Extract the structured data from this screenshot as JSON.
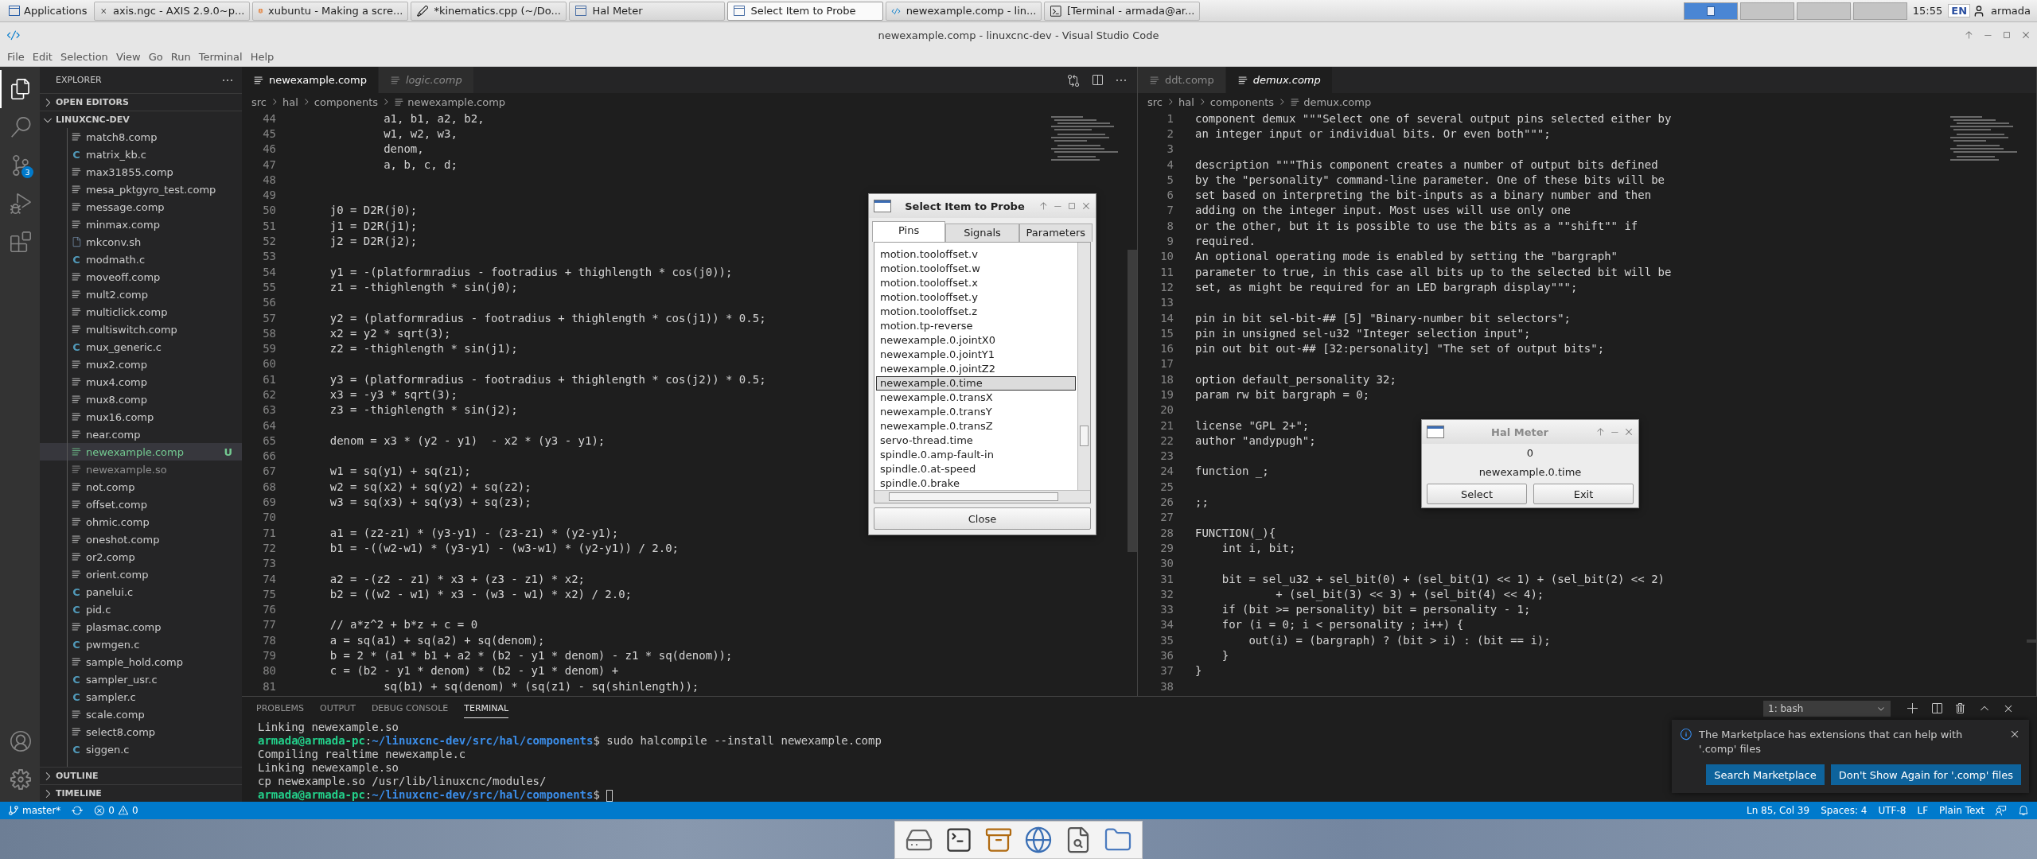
{
  "top_panel": {
    "menu_label": "Applications",
    "tasks": [
      {
        "kind": "axis",
        "label": "axis.ngc - AXIS 2.9.0~p...",
        "selected": false
      },
      {
        "kind": "browser",
        "label": "xubuntu - Making a scre...",
        "selected": false
      },
      {
        "kind": "editor",
        "label": "*kinematics.cpp (~/Do...",
        "selected": false
      },
      {
        "kind": "window",
        "label": "Hal Meter",
        "selected": false
      },
      {
        "kind": "window",
        "label": "Select Item to Probe",
        "selected": true
      },
      {
        "kind": "vscode",
        "label": "newexample.comp - lin...",
        "selected": false
      },
      {
        "kind": "terminal",
        "label": "[Terminal - armada@ar...",
        "selected": false
      }
    ],
    "workspaces": [
      {
        "selected": true
      },
      {
        "selected": false
      },
      {
        "selected": false
      },
      {
        "selected": false
      }
    ],
    "clock": "15:55",
    "keyboard": "EN",
    "user": "armada"
  },
  "window": {
    "title": "newexample.comp - linuxcnc-dev - Visual Studio Code"
  },
  "menu": [
    "File",
    "Edit",
    "Selection",
    "View",
    "Go",
    "Run",
    "Terminal",
    "Help"
  ],
  "activity_bar": {
    "items": [
      {
        "kind": "files",
        "selected": true
      },
      {
        "kind": "search",
        "selected": false
      },
      {
        "kind": "scm",
        "selected": false,
        "badge": "3"
      },
      {
        "kind": "debug",
        "selected": false
      },
      {
        "kind": "extensions",
        "selected": false
      }
    ],
    "bottom": [
      {
        "kind": "account"
      },
      {
        "kind": "settings"
      }
    ]
  },
  "sidebar": {
    "title": "EXPLORER",
    "sections": [
      {
        "label": "OPEN EDITORS",
        "expanded": false
      },
      {
        "label": "LINUXCNC-DEV",
        "expanded": true
      }
    ],
    "files": [
      {
        "name": "match8.comp",
        "kind": "comp",
        "untracked": false,
        "ignored": false,
        "selected": false
      },
      {
        "name": "matrix_kb.c",
        "kind": "c",
        "glyph": "C",
        "untracked": false,
        "ignored": false,
        "selected": false
      },
      {
        "name": "max31855.comp",
        "kind": "comp",
        "untracked": false,
        "ignored": false,
        "selected": false
      },
      {
        "name": "mesa_pktgyro_test.comp",
        "kind": "comp",
        "untracked": false,
        "ignored": false,
        "selected": false
      },
      {
        "name": "message.comp",
        "kind": "comp",
        "untracked": false,
        "ignored": false,
        "selected": false
      },
      {
        "name": "minmax.comp",
        "kind": "comp",
        "untracked": false,
        "ignored": false,
        "selected": false
      },
      {
        "name": "mkconv.sh",
        "kind": "shell",
        "untracked": false,
        "ignored": false,
        "selected": false
      },
      {
        "name": "modmath.c",
        "kind": "c",
        "glyph": "C",
        "untracked": false,
        "ignored": false,
        "selected": false
      },
      {
        "name": "moveoff.comp",
        "kind": "comp",
        "untracked": false,
        "ignored": false,
        "selected": false
      },
      {
        "name": "mult2.comp",
        "kind": "comp",
        "untracked": false,
        "ignored": false,
        "selected": false
      },
      {
        "name": "multiclick.comp",
        "kind": "comp",
        "untracked": false,
        "ignored": false,
        "selected": false
      },
      {
        "name": "multiswitch.comp",
        "kind": "comp",
        "untracked": false,
        "ignored": false,
        "selected": false
      },
      {
        "name": "mux_generic.c",
        "kind": "c",
        "glyph": "C",
        "untracked": false,
        "ignored": false,
        "selected": false
      },
      {
        "name": "mux2.comp",
        "kind": "comp",
        "untracked": false,
        "ignored": false,
        "selected": false
      },
      {
        "name": "mux4.comp",
        "kind": "comp",
        "untracked": false,
        "ignored": false,
        "selected": false
      },
      {
        "name": "mux8.comp",
        "kind": "comp",
        "untracked": false,
        "ignored": false,
        "selected": false
      },
      {
        "name": "mux16.comp",
        "kind": "comp",
        "untracked": false,
        "ignored": false,
        "selected": false
      },
      {
        "name": "near.comp",
        "kind": "comp",
        "untracked": false,
        "ignored": false,
        "selected": false
      },
      {
        "name": "newexample.comp",
        "kind": "comp",
        "untracked": true,
        "ignored": false,
        "badge": "U",
        "selected": true
      },
      {
        "name": "newexample.so",
        "kind": "comp",
        "untracked": false,
        "ignored": true,
        "selected": false
      },
      {
        "name": "not.comp",
        "kind": "comp",
        "untracked": false,
        "ignored": false,
        "selected": false
      },
      {
        "name": "offset.comp",
        "kind": "comp",
        "untracked": false,
        "ignored": false,
        "selected": false
      },
      {
        "name": "ohmic.comp",
        "kind": "comp",
        "untracked": false,
        "ignored": false,
        "selected": false
      },
      {
        "name": "oneshot.comp",
        "kind": "comp",
        "untracked": false,
        "ignored": false,
        "selected": false
      },
      {
        "name": "or2.comp",
        "kind": "comp",
        "untracked": false,
        "ignored": false,
        "selected": false
      },
      {
        "name": "orient.comp",
        "kind": "comp",
        "untracked": false,
        "ignored": false,
        "selected": false
      },
      {
        "name": "panelui.c",
        "kind": "c",
        "glyph": "C",
        "untracked": false,
        "ignored": false,
        "selected": false
      },
      {
        "name": "pid.c",
        "kind": "c",
        "glyph": "C",
        "untracked": false,
        "ignored": false,
        "selected": false
      },
      {
        "name": "plasmac.comp",
        "kind": "comp",
        "untracked": false,
        "ignored": false,
        "selected": false
      },
      {
        "name": "pwmgen.c",
        "kind": "c",
        "glyph": "C",
        "untracked": false,
        "ignored": false,
        "selected": false
      },
      {
        "name": "sample_hold.comp",
        "kind": "comp",
        "untracked": false,
        "ignored": false,
        "selected": false
      },
      {
        "name": "sampler_usr.c",
        "kind": "c",
        "glyph": "C",
        "untracked": false,
        "ignored": false,
        "selected": false
      },
      {
        "name": "sampler.c",
        "kind": "c",
        "glyph": "C",
        "untracked": false,
        "ignored": false,
        "selected": false
      },
      {
        "name": "scale.comp",
        "kind": "comp",
        "untracked": false,
        "ignored": false,
        "selected": false
      },
      {
        "name": "select8.comp",
        "kind": "comp",
        "untracked": false,
        "ignored": false,
        "selected": false
      },
      {
        "name": "siggen.c",
        "kind": "c",
        "glyph": "C",
        "untracked": false,
        "ignored": false,
        "selected": false
      }
    ],
    "bottom_sections": [
      {
        "label": "OUTLINE",
        "expanded": false
      },
      {
        "label": "TIMELINE",
        "expanded": false
      }
    ]
  },
  "editor_groups": [
    {
      "tabs": [
        {
          "label": "newexample.comp",
          "selected": true,
          "preview": false
        },
        {
          "label": "logic.comp",
          "selected": false,
          "preview": true
        }
      ],
      "actions": [
        {
          "kind": "compare"
        },
        {
          "kind": "split"
        },
        {
          "kind": "more"
        }
      ],
      "breadcrumb": [
        "src",
        "hal",
        "components",
        "newexample.comp"
      ],
      "lines": [
        {
          "n": "44",
          "text": "            a1, b1, a2, b2,"
        },
        {
          "n": "45",
          "text": "            w1, w2, w3,"
        },
        {
          "n": "46",
          "text": "            denom,"
        },
        {
          "n": "47",
          "text": "            a, b, c, d;"
        },
        {
          "n": "48"
        },
        {
          "n": "49"
        },
        {
          "n": "50",
          "text": "    j0 = D2R(j0);"
        },
        {
          "n": "51",
          "text": "    j1 = D2R(j1);"
        },
        {
          "n": "52",
          "text": "    j2 = D2R(j2);"
        },
        {
          "n": "53"
        },
        {
          "n": "54",
          "text": "    y1 = -(platformradius - footradius + thighlength * cos(j0));"
        },
        {
          "n": "55",
          "text": "    z1 = -thighlength * sin(j0);"
        },
        {
          "n": "56"
        },
        {
          "n": "57",
          "text": "    y2 = (platformradius - footradius + thighlength * cos(j1)) * 0.5;"
        },
        {
          "n": "58",
          "text": "    x2 = y2 * sqrt(3);"
        },
        {
          "n": "59",
          "text": "    z2 = -thighlength * sin(j1);"
        },
        {
          "n": "60"
        },
        {
          "n": "61",
          "text": "    y3 = (platformradius - footradius + thighlength * cos(j2)) * 0.5;"
        },
        {
          "n": "62",
          "text": "    x3 = -y3 * sqrt(3);"
        },
        {
          "n": "63",
          "text": "    z3 = -thighlength * sin(j2);"
        },
        {
          "n": "64"
        },
        {
          "n": "65",
          "text": "    denom = x3 * (y2 - y1)  - x2 * (y3 - y1);"
        },
        {
          "n": "66"
        },
        {
          "n": "67",
          "text": "    w1 = sq(y1) + sq(z1);"
        },
        {
          "n": "68",
          "text": "    w2 = sq(x2) + sq(y2) + sq(z2);"
        },
        {
          "n": "69",
          "text": "    w3 = sq(x3) + sq(y3) + sq(z3);"
        },
        {
          "n": "70"
        },
        {
          "n": "71",
          "text": "    a1 = (z2-z1) * (y3-y1) - (z3-z1) * (y2-y1);"
        },
        {
          "n": "72",
          "text": "    b1 = -((w2-w1) * (y3-y1) - (w3-w1) * (y2-y1)) / 2.0;"
        },
        {
          "n": "73"
        },
        {
          "n": "74",
          "text": "    a2 = -(z2 - z1) * x3 + (z3 - z1) * x2;"
        },
        {
          "n": "75",
          "text": "    b2 = ((w2 - w1) * x3 - (w3 - w1) * x2) / 2.0;"
        },
        {
          "n": "76"
        },
        {
          "n": "77",
          "text": "    // a*z^2 + b*z + c = 0"
        },
        {
          "n": "78",
          "text": "    a = sq(a1) + sq(a2) + sq(denom);"
        },
        {
          "n": "79",
          "text": "    b = 2 * (a1 * b1 + a2 * (b2 - y1 * denom) - z1 * sq(denom));"
        },
        {
          "n": "80",
          "text": "    c = (b2 - y1 * denom) * (b2 - y1 * denom) +"
        },
        {
          "n": "81",
          "text": "            sq(b1) + sq(denom) * (sq(z1) - sq(shinlength));"
        }
      ]
    },
    {
      "tabs": [
        {
          "label": "ddt.comp",
          "selected": false,
          "preview": false
        },
        {
          "label": "demux.comp",
          "selected": true,
          "preview": true
        }
      ],
      "breadcrumb": [
        "src",
        "hal",
        "components",
        "demux.comp"
      ],
      "lines": [
        {
          "n": "1",
          "text": "component demux \"\"\"Select one of several output pins selected either by"
        },
        {
          "n": "2",
          "text": "an integer input or individual bits. Or even both\"\"\";"
        },
        {
          "n": "3"
        },
        {
          "n": "4",
          "text": "description \"\"\"This component creates a number of output bits defined"
        },
        {
          "n": "5",
          "text": "by the \"personality\" command-line parameter. One of these bits will be"
        },
        {
          "n": "6",
          "text": "set based on interpreting the bit-inputs as a binary number and then"
        },
        {
          "n": "7",
          "text": "adding on the integer input. Most uses will use only one"
        },
        {
          "n": "8",
          "text": "or the other, but it is possible to use the bits as a \"\"shift\"\" if"
        },
        {
          "n": "9",
          "text": "required."
        },
        {
          "n": "10",
          "text": "An optional operating mode is enabled by setting the \"bargraph\""
        },
        {
          "n": "11",
          "text": "parameter to true, in this case all bits up to the selected bit will be"
        },
        {
          "n": "12",
          "text": "set, as might be required for an LED bargraph display\"\"\";"
        },
        {
          "n": "13"
        },
        {
          "n": "14",
          "text": "pin in bit sel-bit-## [5] \"Binary-number bit selectors\";"
        },
        {
          "n": "15",
          "text": "pin in unsigned sel-u32 \"Integer selection input\";"
        },
        {
          "n": "16",
          "text": "pin out bit out-## [32:personality] \"The set of output bits\";"
        },
        {
          "n": "17"
        },
        {
          "n": "18",
          "text": "option default_personality 32;"
        },
        {
          "n": "19",
          "text": "param rw bit bargraph = 0;"
        },
        {
          "n": "20"
        },
        {
          "n": "21",
          "text": "license \"GPL 2+\";"
        },
        {
          "n": "22",
          "text": "author \"andypugh\";"
        },
        {
          "n": "23"
        },
        {
          "n": "24",
          "text": "function _;"
        },
        {
          "n": "25"
        },
        {
          "n": "26",
          "text": ";;"
        },
        {
          "n": "27"
        },
        {
          "n": "28",
          "text": "FUNCTION(_){"
        },
        {
          "n": "29",
          "text": "    int i, bit;"
        },
        {
          "n": "30"
        },
        {
          "n": "31",
          "text": "    bit = sel_u32 + sel_bit(0) + (sel_bit(1) << 1) + (sel_bit(2) << 2)"
        },
        {
          "n": "32",
          "text": "            + (sel_bit(3) << 3) + (sel_bit(4) << 4);"
        },
        {
          "n": "33",
          "text": "    if (bit >= personality) bit = personality - 1;"
        },
        {
          "n": "34",
          "text": "    for (i = 0; i < personality ; i++) {"
        },
        {
          "n": "35",
          "text": "        out(i) = (bargraph) ? (bit > i) : (bit == i);"
        },
        {
          "n": "36",
          "text": "    }"
        },
        {
          "n": "37",
          "text": "}"
        },
        {
          "n": "38"
        }
      ]
    }
  ],
  "panel": {
    "tabs": [
      {
        "label": "PROBLEMS",
        "selected": false
      },
      {
        "label": "OUTPUT",
        "selected": false
      },
      {
        "label": "DEBUG CONSOLE",
        "selected": false
      },
      {
        "label": "TERMINAL",
        "selected": true
      }
    ],
    "terminal_select": "1: bash",
    "lines": [
      {
        "kind": "output",
        "text": "Linking newexample.so"
      },
      {
        "kind": "prompt",
        "user": "armada@armada-pc",
        "sep": ":",
        "path": "~/linuxcnc-dev/src/hal/components",
        "command": "$ sudo halcompile --install newexample.comp"
      },
      {
        "kind": "output",
        "text": "Compiling realtime newexample.c"
      },
      {
        "kind": "output",
        "text": "Linking newexample.so"
      },
      {
        "kind": "output",
        "text": "cp newexample.so /usr/lib/linuxcnc/modules/"
      },
      {
        "kind": "prompt",
        "user": "armada@armada-pc",
        "sep": ":",
        "path": "~/linuxcnc-dev/src/hal/components",
        "command": "$ ",
        "cursor": true
      }
    ]
  },
  "status_bar": {
    "branch": "master*",
    "errors": "0",
    "warnings": "0",
    "items": [
      "Ln 85, Col 39",
      "Spaces: 4",
      "UTF-8",
      "LF",
      "Plain Text"
    ]
  },
  "probe_dialog": {
    "title": "Select Item to Probe",
    "tabs": [
      {
        "label": "Pins",
        "selected": true
      },
      {
        "label": "Signals",
        "selected": false
      },
      {
        "label": "Parameters",
        "selected": false
      }
    ],
    "items": [
      {
        "label": "motion.tooloffset.v",
        "selected": false
      },
      {
        "label": "motion.tooloffset.w",
        "selected": false
      },
      {
        "label": "motion.tooloffset.x",
        "selected": false
      },
      {
        "label": "motion.tooloffset.y",
        "selected": false
      },
      {
        "label": "motion.tooloffset.z",
        "selected": false
      },
      {
        "label": "motion.tp-reverse",
        "selected": false
      },
      {
        "label": "newexample.0.jointX0",
        "selected": false
      },
      {
        "label": "newexample.0.jointY1",
        "selected": false
      },
      {
        "label": "newexample.0.jointZ2",
        "selected": false
      },
      {
        "label": "newexample.0.time",
        "selected": true
      },
      {
        "label": "newexample.0.transX",
        "selected": false
      },
      {
        "label": "newexample.0.transY",
        "selected": false
      },
      {
        "label": "newexample.0.transZ",
        "selected": false
      },
      {
        "label": "servo-thread.time",
        "selected": false
      },
      {
        "label": "spindle.0.amp-fault-in",
        "selected": false
      },
      {
        "label": "spindle.0.at-speed",
        "selected": false
      },
      {
        "label": "spindle.0.brake",
        "selected": false
      }
    ],
    "close": "Close"
  },
  "hal_meter": {
    "title": "Hal Meter",
    "value": "0",
    "pin": "newexample.0.time",
    "buttons": [
      "Select",
      "Exit"
    ]
  },
  "notification": {
    "message": "The Marketplace has extensions that can help with '.comp' files",
    "buttons": [
      "Search Marketplace",
      "Don't Show Again for '.comp' files"
    ]
  },
  "dock": [
    {
      "kind": "drive"
    },
    {
      "kind": "terminal"
    },
    {
      "kind": "archive"
    },
    {
      "kind": "globe"
    },
    {
      "kind": "viewer"
    },
    {
      "kind": "folder"
    }
  ]
}
